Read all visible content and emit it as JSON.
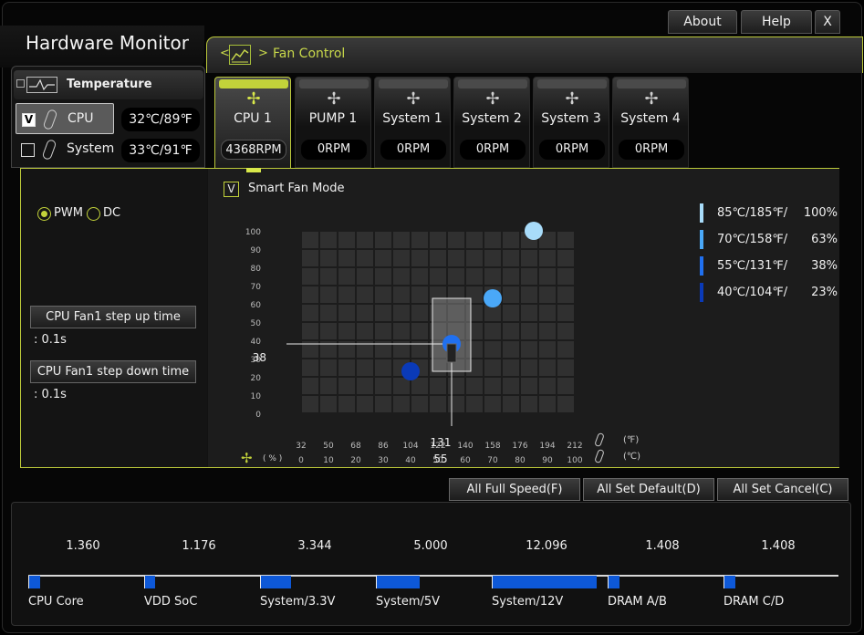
{
  "window_buttons": {
    "about": "About",
    "help": "Help",
    "close": "X"
  },
  "app_title": "Hardware Monitor",
  "fan_control": {
    "nav_prev": "<",
    "nav_next": ">",
    "title": "Fan Control"
  },
  "temperature": {
    "title": "Temperature",
    "rows": [
      {
        "name": "CPU",
        "value": "32℃/89℉",
        "checked": true,
        "check_mark": "V"
      },
      {
        "name": "System",
        "value": "33℃/91℉",
        "checked": false,
        "check_mark": ""
      }
    ]
  },
  "fans": [
    {
      "name": "CPU 1",
      "rpm": "4368RPM"
    },
    {
      "name": "PUMP 1",
      "rpm": "0RPM"
    },
    {
      "name": "System 1",
      "rpm": "0RPM"
    },
    {
      "name": "System 2",
      "rpm": "0RPM"
    },
    {
      "name": "System 3",
      "rpm": "0RPM"
    },
    {
      "name": "System 4",
      "rpm": "0RPM"
    }
  ],
  "mode": {
    "pwm": "PWM",
    "dc": "DC",
    "selected": "PWM"
  },
  "step": {
    "up_label": "CPU Fan1 step up time",
    "up_value": ": 0.1s",
    "down_label": "CPU Fan1 step down time",
    "down_value": ": 0.1s"
  },
  "smart_fan": {
    "label": "Smart Fan Mode",
    "check_mark": "V"
  },
  "chart_data": {
    "type": "scatter",
    "title": "",
    "xlabel_f": "(℉)",
    "xlabel_c": "(℃)",
    "ylabel": "( % )",
    "y_ticks": [
      100,
      90,
      80,
      70,
      60,
      50,
      40,
      30,
      20,
      10,
      0
    ],
    "x_ticks_f": [
      32,
      50,
      68,
      86,
      104,
      122,
      140,
      158,
      176,
      194,
      212
    ],
    "x_ticks_c": [
      0,
      10,
      20,
      30,
      40,
      50,
      60,
      70,
      80,
      90,
      100
    ],
    "xlim": [
      0,
      100
    ],
    "ylim": [
      0,
      100
    ],
    "points": [
      {
        "temp_c": 40,
        "temp_f": 104,
        "percent": 23,
        "color": "#0a3ab8"
      },
      {
        "temp_c": 55,
        "temp_f": 131,
        "percent": 38,
        "color": "#2070f0"
      },
      {
        "temp_c": 70,
        "temp_f": 158,
        "percent": 63,
        "color": "#4aa8f8"
      },
      {
        "temp_c": 85,
        "temp_f": 185,
        "percent": 100,
        "color": "#a8dcfa"
      }
    ],
    "cursor": {
      "percent": "38",
      "temp_f": "131",
      "temp_c": "55"
    }
  },
  "legend": [
    {
      "temp": "85℃/185℉/",
      "percent": "100%",
      "color": "#a8dcfa"
    },
    {
      "temp": "70℃/158℉/",
      "percent": "63%",
      "color": "#4aa8f8"
    },
    {
      "temp": "55℃/131℉/",
      "percent": "38%",
      "color": "#2070f0"
    },
    {
      "temp": "40℃/104℉/",
      "percent": "23%",
      "color": "#0a3ab8"
    }
  ],
  "actions": {
    "full_speed": "All Full Speed(F)",
    "set_default": "All Set Default(D)",
    "set_cancel": "All Set Cancel(C)"
  },
  "voltages": [
    {
      "label": "CPU Core",
      "value": "1.360",
      "level": 0.11
    },
    {
      "label": "VDD SoC",
      "value": "1.176",
      "level": 0.1
    },
    {
      "label": "System/3.3V",
      "value": "3.344",
      "level": 0.28
    },
    {
      "label": "System/5V",
      "value": "5.000",
      "level": 0.4
    },
    {
      "label": "System/12V",
      "value": "12.096",
      "level": 0.96
    },
    {
      "label": "DRAM A/B",
      "value": "1.408",
      "level": 0.11
    },
    {
      "label": "DRAM C/D",
      "value": "1.408",
      "level": 0.11
    }
  ],
  "accent_color": "#c2d23a",
  "bar_color": "#0d58d8"
}
